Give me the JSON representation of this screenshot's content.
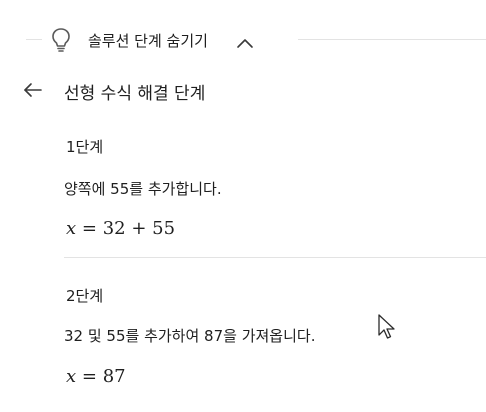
{
  "toggle": {
    "label": "솔루션 단계 숨기기",
    "icon": "lightbulb-icon",
    "chevron_icon": "chevron-up-icon"
  },
  "header": {
    "back_icon": "arrow-left-icon",
    "title": "선형 수식 해결 단계"
  },
  "steps": [
    {
      "heading": "1단계",
      "description": "양쪽에 55를 추가합니다.",
      "equation": {
        "variable": "x",
        "rhs": "= 32 + 55"
      }
    },
    {
      "heading": "2단계",
      "description": "32 및 55를 추가하여 87을 가져옵니다.",
      "equation": {
        "variable": "x",
        "rhs": "= 87"
      }
    }
  ],
  "colors": {
    "text": "#1f1f1f",
    "divider": "#e3e3e3",
    "background": "#ffffff"
  }
}
